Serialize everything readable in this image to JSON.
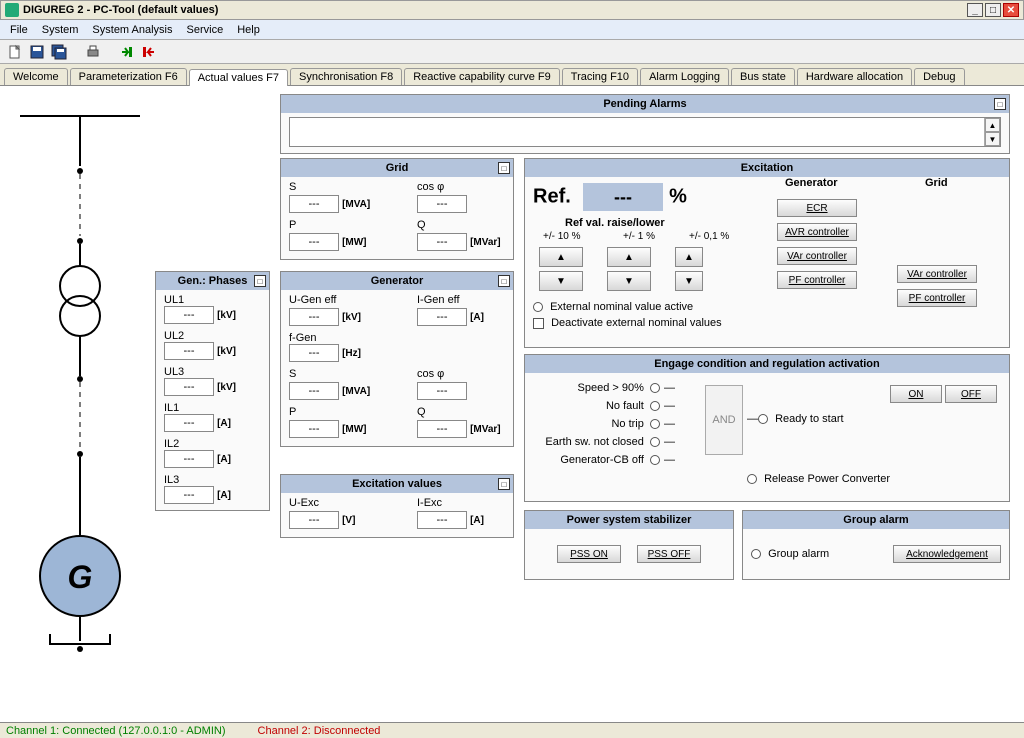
{
  "window": {
    "title": "DIGUREG 2 - PC-Tool   (default values)"
  },
  "menu": [
    "File",
    "System",
    "System Analysis",
    "Service",
    "Help"
  ],
  "tabs": [
    "Welcome",
    "Parameterization  F6",
    "Actual values  F7",
    "Synchronisation  F8",
    "Reactive capability curve  F9",
    "Tracing  F10",
    "Alarm Logging",
    "Bus state",
    "Hardware allocation",
    "Debug"
  ],
  "activeTab": "Actual values  F7",
  "diagram": {
    "gen_label": "G"
  },
  "pending": {
    "title": "Pending Alarms"
  },
  "grid": {
    "title": "Grid",
    "s_label": "S",
    "s_val": "---",
    "s_unit": "[MVA]",
    "cos_label": "cos φ",
    "cos_val": "---",
    "p_label": "P",
    "p_val": "---",
    "p_unit": "[MW]",
    "q_label": "Q",
    "q_val": "---",
    "q_unit": "[MVar]"
  },
  "genphases": {
    "title": "Gen.: Phases",
    "UL1_l": "UL1",
    "UL1_v": "---",
    "UL1_u": "[kV]",
    "UL2_l": "UL2",
    "UL2_v": "---",
    "UL2_u": "[kV]",
    "UL3_l": "UL3",
    "UL3_v": "---",
    "UL3_u": "[kV]",
    "IL1_l": "IL1",
    "IL1_v": "---",
    "IL1_u": "[A]",
    "IL2_l": "IL2",
    "IL2_v": "---",
    "IL2_u": "[A]",
    "IL3_l": "IL3",
    "IL3_v": "---",
    "IL3_u": "[A]"
  },
  "generator": {
    "title": "Generator",
    "ug_l": "U-Gen eff",
    "ug_v": "---",
    "ug_u": "[kV]",
    "ig_l": "I-Gen eff",
    "ig_v": "---",
    "ig_u": "[A]",
    "f_l": "f-Gen",
    "f_v": "---",
    "f_u": "[Hz]",
    "s_l": "S",
    "s_v": "---",
    "s_u": "[MVA]",
    "cos_l": "cos φ",
    "cos_v": "---",
    "p_l": "P",
    "p_v": "---",
    "p_u": "[MW]",
    "q_l": "Q",
    "q_v": "---",
    "q_u": "[MVar]"
  },
  "excvals": {
    "title": "Excitation values",
    "u_l": "U-Exc",
    "u_v": "---",
    "u_u": "[V]",
    "i_l": "I-Exc",
    "i_v": "---",
    "i_u": "[A]"
  },
  "excitation": {
    "title": "Excitation",
    "ref_label": "Ref.",
    "ref_val": "---",
    "ref_pct": "%",
    "gen_hdr": "Generator",
    "grid_hdr": "Grid",
    "raise_lower": "Ref val. raise/lower",
    "pm10": "+/- 10 %",
    "pm1": "+/- 1 %",
    "pm01": "+/- 0,1 %",
    "ext_nominal": "External nominal value active",
    "deact_ext": "Deactivate external nominal values",
    "ecr": "ECR",
    "avr": "AVR controller",
    "var": "VAr controller",
    "pf": "PF controller"
  },
  "engage": {
    "title": "Engage condition and regulation activation",
    "speed": "Speed > 90%",
    "nofault": "No fault",
    "notrip": "No trip",
    "earth": "Earth sw. not closed",
    "gencb": "Generator-CB off",
    "and": "AND",
    "ready": "Ready to start",
    "on": "ON",
    "off": "OFF",
    "release": "Release Power Converter"
  },
  "pss": {
    "title": "Power system stabilizer",
    "on": "PSS ON",
    "off": "PSS OFF"
  },
  "groupalarm": {
    "title": "Group alarm",
    "label": "Group alarm",
    "ack": "Acknowledgement"
  },
  "status": {
    "ch1": "Channel 1: Connected (127.0.0.1:0 - ADMIN)",
    "ch2": "Channel 2: Disconnected"
  }
}
